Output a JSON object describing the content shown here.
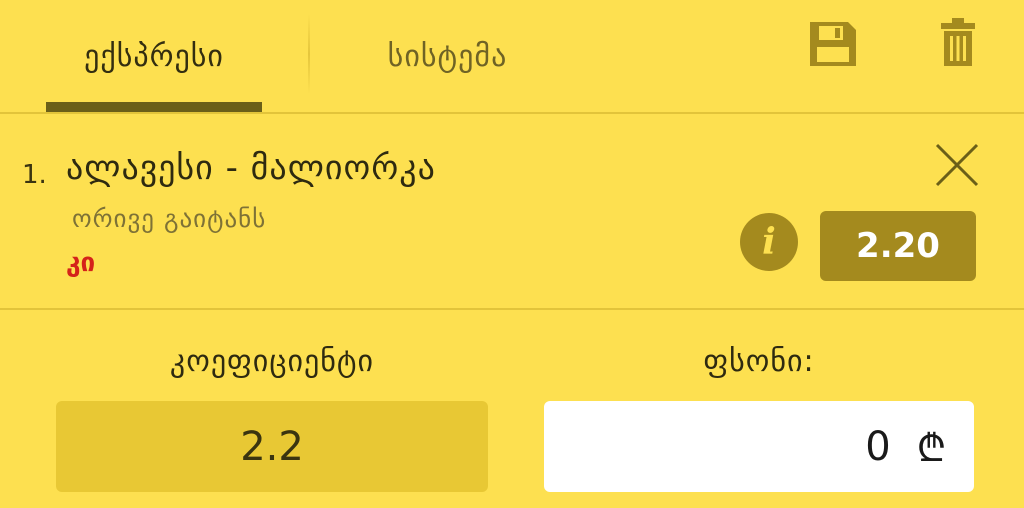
{
  "tabs": [
    {
      "label": "ექსპრესი",
      "active": true
    },
    {
      "label": "სისტემა",
      "active": false
    }
  ],
  "toolbar": {
    "save_icon": "save-icon",
    "delete_icon": "trash-icon"
  },
  "bet": {
    "index": "1.",
    "match": "ალავესი - მალიორკა",
    "market": "ორივე გაიტანს",
    "pick": "კი",
    "odds": "2.20",
    "info_icon": "info-icon",
    "close_icon": "close-icon"
  },
  "summary": {
    "coefficient_label": "კოეფიციენტი",
    "coefficient_value": "2.2",
    "stake_label": "ფსონი:",
    "stake_value": "0",
    "currency_symbol": "₾"
  },
  "colors": {
    "background": "#fde050",
    "accent_dark": "#a48a1e",
    "pick_red": "#d4231a",
    "coef_box": "#e8c834"
  }
}
